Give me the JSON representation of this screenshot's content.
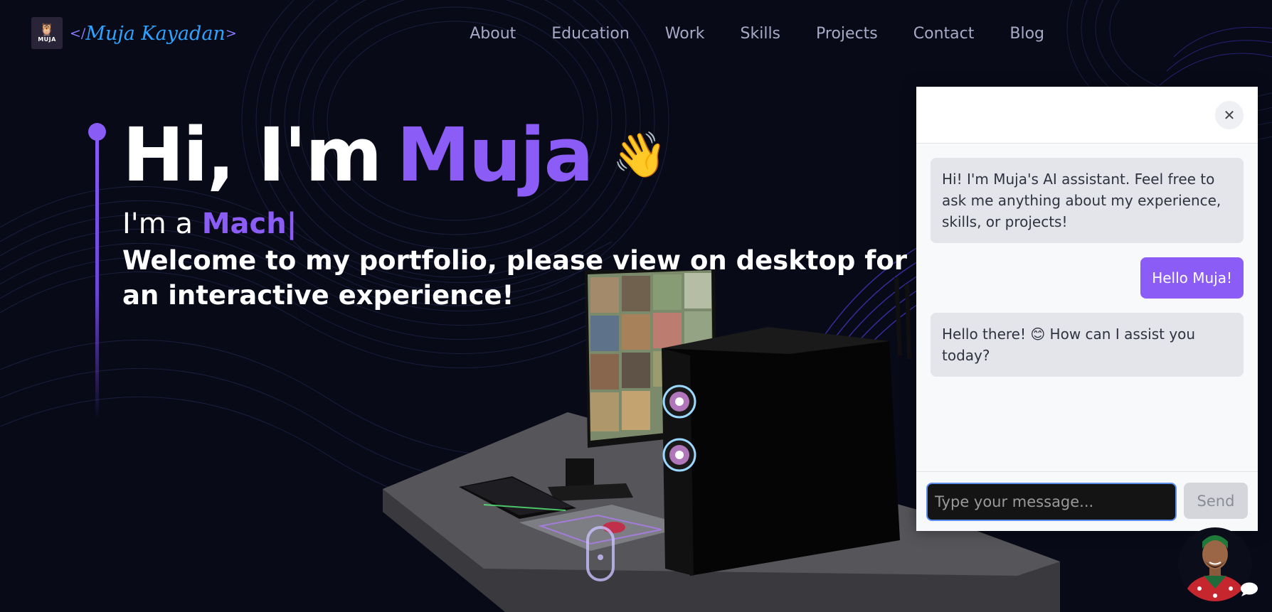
{
  "brand": {
    "logo_text": "MUJA",
    "name": "Muja Kayadan",
    "open_bracket": "</",
    "close_bracket": ">"
  },
  "nav": {
    "items": [
      "About",
      "Education",
      "Work",
      "Skills",
      "Projects",
      "Contact",
      "Blog"
    ]
  },
  "hero": {
    "greeting": "Hi, I'm",
    "name": "Muja",
    "wave_emoji": "👋",
    "im_a": "I'm a",
    "role_typed": "Mach",
    "cursor": "|",
    "welcome": "Welcome to my portfolio, please view on desktop for an interactive experience!"
  },
  "chat": {
    "close_symbol": "✕",
    "messages": [
      {
        "from": "bot",
        "text": "Hi! I'm Muja's AI assistant. Feel free to ask me anything about my experience, skills, or projects!"
      },
      {
        "from": "user",
        "text": "Hello Muja!"
      },
      {
        "from": "bot",
        "text": "Hello there! 😊 How can I assist you today?"
      }
    ],
    "input_placeholder": "Type your message...",
    "send_label": "Send"
  },
  "colors": {
    "background": "#080a18",
    "accent": "#8b5cf6",
    "nav_text": "#a8a9c7",
    "brand_text": "#2ea3ff"
  },
  "icons": {
    "logo": "owl-icon",
    "close": "close-icon",
    "avatar": "avatar",
    "chat_bubble": "chat-bubble-icon",
    "scroll": "scroll-mouse-icon"
  }
}
